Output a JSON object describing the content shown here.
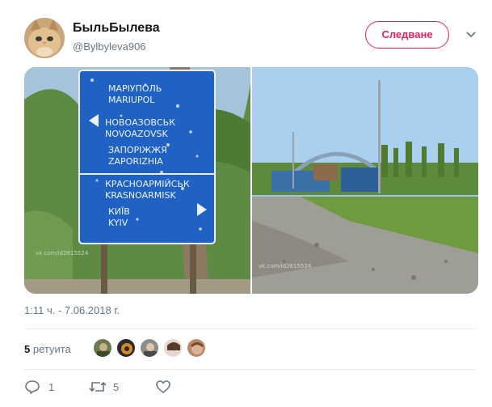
{
  "user": {
    "display_name": "БыльБылева",
    "handle": "@Bylbyleva906",
    "avatar_icon": "cat-avatar"
  },
  "follow_button": {
    "label": "Следване",
    "color": "#e0245e"
  },
  "menu_icon": "chevron-down-icon",
  "media": {
    "left_photo": {
      "sign_lines": [
        {
          "cyr": "МАРІУПОЛЬ",
          "lat": "MARIUPOL"
        },
        {
          "cyr": "НОВОАЗОВСЬК",
          "lat": "NOVOAZOVSK"
        },
        {
          "cyr": "ЗАПОРІЖЖЯ",
          "lat": "ZAPORIZHIA"
        },
        {
          "cyr": "КРАСНОАРМІЙСЬК",
          "lat": "KRASNOARMISK"
        },
        {
          "cyr": "КИЇВ",
          "lat": "KYIV"
        }
      ],
      "watermark": "vk.com/id2615524"
    },
    "right_photo": {
      "watermark": "vk.com/id2615524"
    }
  },
  "timestamp": "1:11 ч. - 7.06.2018 г.",
  "retweets": {
    "count": "5",
    "label": "ретуита"
  },
  "actions": {
    "reply": {
      "icon": "reply-icon",
      "count": "1"
    },
    "retweet": {
      "icon": "retweet-icon",
      "count": "5"
    },
    "like": {
      "icon": "heart-icon",
      "count": ""
    }
  },
  "colors": {
    "accent": "#e0245e",
    "secondary_text": "#657786",
    "divider": "#e6ecf0"
  }
}
